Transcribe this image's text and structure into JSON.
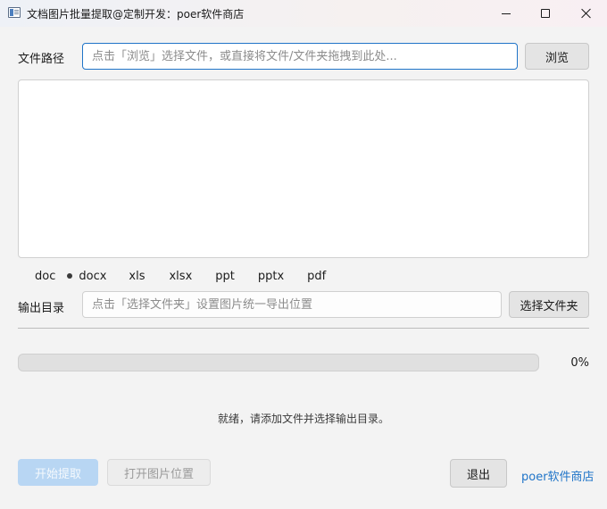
{
  "window": {
    "title": "文档图片批量提取@定制开发：poer软件商店"
  },
  "file_path": {
    "label": "文件路径",
    "placeholder": "点击「浏览」选择文件，或直接将文件/文件夹拖拽到此处...",
    "browse_label": "浏览"
  },
  "formats": [
    "doc",
    "docx",
    "xls",
    "xlsx",
    "ppt",
    "pptx",
    "pdf"
  ],
  "output": {
    "label": "输出目录",
    "placeholder": "点击「选择文件夹」设置图片统一导出位置",
    "choose_label": "选择文件夹"
  },
  "progress": {
    "value": 0,
    "text": "0%"
  },
  "status": {
    "text": "就绪，请添加文件并选择输出目录。"
  },
  "actions": {
    "start_label": "开始提取",
    "open_label": "打开图片位置",
    "exit_label": "退出",
    "store_link": "poer软件商店"
  },
  "colors": {
    "accent": "#1f74c8",
    "start_disabled": "#b8d6f3"
  }
}
